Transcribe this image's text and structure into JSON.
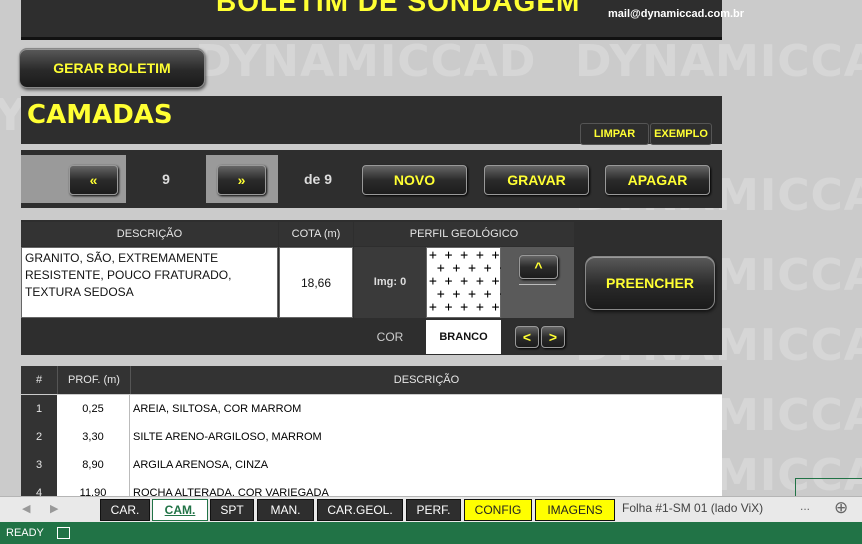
{
  "header": {
    "title": "BOLETIM DE SONDAGEM",
    "email": "mail@dynamiccad.com.br"
  },
  "watermark": "DYNAMICCAD",
  "actions": {
    "gerar_boletim": "GERAR BOLETIM"
  },
  "camadas": {
    "title": "CAMADAS",
    "limpar": "LIMPAR",
    "exemplo": "EXEMPLO"
  },
  "navigator": {
    "prev": "«",
    "current": "9",
    "next": "»",
    "total": "de 9",
    "novo": "NOVO",
    "gravar": "GRAVAR",
    "apagar": "APAGAR"
  },
  "editor": {
    "headers": {
      "descricao": "DESCRIÇÃO",
      "cota": "COTA (m)",
      "perfil": "PERFIL GEOLÓGICO"
    },
    "descricao_value": "GRANITO, SÃO, EXTREMAMENTE RESISTENTE, POUCO FRATURADO, TEXTURA SEDOSA",
    "cota_value": "18,66",
    "img_label": "Img: 0",
    "up": "^",
    "preencher": "PREENCHER",
    "cor_label": "COR",
    "cor_value": "BRANCO",
    "cor_prev": "<",
    "cor_next": ">"
  },
  "layers_table": {
    "headers": [
      "#",
      "PROF. (m)",
      "DESCRIÇÃO"
    ],
    "rows": [
      {
        "n": "1",
        "prof": "0,25",
        "desc": "AREIA, SILTOSA, COR MARROM"
      },
      {
        "n": "2",
        "prof": "3,30",
        "desc": "SILTE ARENO-ARGILOSO, MARROM"
      },
      {
        "n": "3",
        "prof": "8,90",
        "desc": "ARGILA ARENOSA, CINZA"
      },
      {
        "n": "4",
        "prof": "11,90",
        "desc": "ROCHA ALTERADA, COR VARIEGADA"
      }
    ]
  },
  "tabs": {
    "car": "CAR.",
    "cam": "CAM.",
    "spt": "SPT",
    "man": "MAN.",
    "car_geol": "CAR.GEOL.",
    "perf": "PERF.",
    "config": "CONFIG",
    "imagens": "IMAGENS",
    "folha": "Folha #1-SM 01 (lado ViX)",
    "more": "...",
    "add": "⊕",
    "active": "CAM.",
    "accent_yellow": "#ffff00"
  },
  "status_bar": {
    "ready": "READY"
  }
}
